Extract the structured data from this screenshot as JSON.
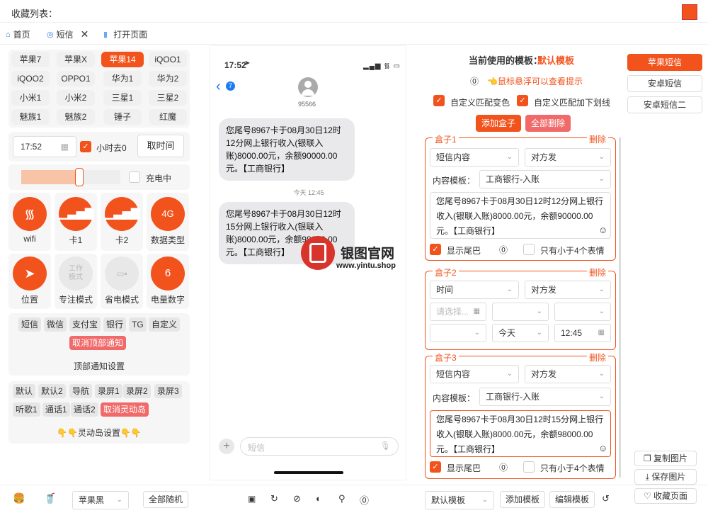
{
  "header": {
    "title": "收藏列表：",
    "accent": "#f2531d"
  },
  "tabs": [
    {
      "label": "首页",
      "icon": "home-icon"
    },
    {
      "label": "短信",
      "icon": "chat-icon"
    },
    {
      "label": "打开页面",
      "icon": "page-icon"
    }
  ],
  "models": [
    "苹果7",
    "苹果X",
    "苹果14",
    "iQOO1",
    "iQOO2",
    "OPPO1",
    "华为1",
    "华为2",
    "小米1",
    "小米2",
    "三星1",
    "三星2",
    "魅族1",
    "魅族2",
    "锤子",
    "红魔"
  ],
  "time": {
    "value": "17:52",
    "hide_zero": "小时去0",
    "button": "取时间"
  },
  "battery": {
    "charging": "充电中"
  },
  "toggles": [
    {
      "label": "wifi",
      "icon": "wifi-icon"
    },
    {
      "label": "卡1",
      "icon": "signal-icon"
    },
    {
      "label": "卡2",
      "icon": "signal-icon"
    },
    {
      "label": "数据类型",
      "value": "4G"
    },
    {
      "label": "位置",
      "icon": "location-icon"
    },
    {
      "label": "专注模式",
      "value": "工作\n模式"
    },
    {
      "label": "省电模式",
      "icon": "battery-icon"
    },
    {
      "label": "电量数字",
      "value": "6"
    }
  ],
  "notify_tags": [
    "短信",
    "微信",
    "支付宝",
    "银行",
    "TG",
    "自定义"
  ],
  "notify_cancel": "取消顶部通知",
  "notify_title": "顶部通知设置",
  "island_tags": [
    "默认",
    "默认2",
    "导航",
    "录屏1",
    "录屏2",
    "录屏3",
    "听歌1",
    "通话1",
    "通话2"
  ],
  "island_cancel": "取消灵动岛",
  "island_title": "👇👇灵动岛设置👇👇",
  "phone": {
    "time": "17:52",
    "sender": "95566",
    "badge": "7",
    "time_sep": "今天 12:45",
    "msg1": "您尾号8967卡于08月30日12时12分网上银行收入(银联入账)8000.00元，余额90000.00元。【工商银行】",
    "msg2": "您尾号8967卡于08月30日12时15分网上银行收入(银联入账)8000.00元，余额98000.00元。【工商银行】",
    "input_placeholder": "短信"
  },
  "watermark": {
    "name": "银图官网",
    "url": "www.yintu.shop"
  },
  "config": {
    "current_label": "当前使用的模板：",
    "current_value": "默认模板",
    "hint": "👈鼠标悬浮可以查看提示",
    "cb1": "自定义匹配变色",
    "cb2": "自定义匹配加下划线",
    "add_box": "添加盒子",
    "delete_all": "全部删除",
    "delete": "删除",
    "content_template_label": "内容模板：",
    "show_tail": "显示尾巴",
    "emoji_only": "只有小于4个表情"
  },
  "boxes": [
    {
      "title": "盒子1",
      "type": "短信内容",
      "dir": "对方发",
      "template": "工商银行-入账",
      "text": "您尾号8967卡于08月30日12时12分网上银行收入(银联入账)8000.00元，余额90000.00元。【工商银行】"
    },
    {
      "title": "盒子2",
      "type": "时间",
      "dir": "对方发",
      "date_placeholder": "请选择...",
      "day": "今天",
      "time": "12:45"
    },
    {
      "title": "盒子3",
      "type": "短信内容",
      "dir": "对方发",
      "template": "工商银行-入账",
      "text": "您尾号8967卡于08月30日12时15分网上银行收入(银联入账)8000.00元，余额98000.00元。【工商银行】"
    }
  ],
  "phone_types": [
    "苹果短信",
    "安卓短信",
    "安卓短信二"
  ],
  "actions": [
    "复制图片",
    "保存图片",
    "收藏页面"
  ],
  "bottom": {
    "theme": "苹果黑",
    "random": "全部随机",
    "template": "默认模板",
    "add_template": "添加模板",
    "edit_template": "编辑模板"
  }
}
